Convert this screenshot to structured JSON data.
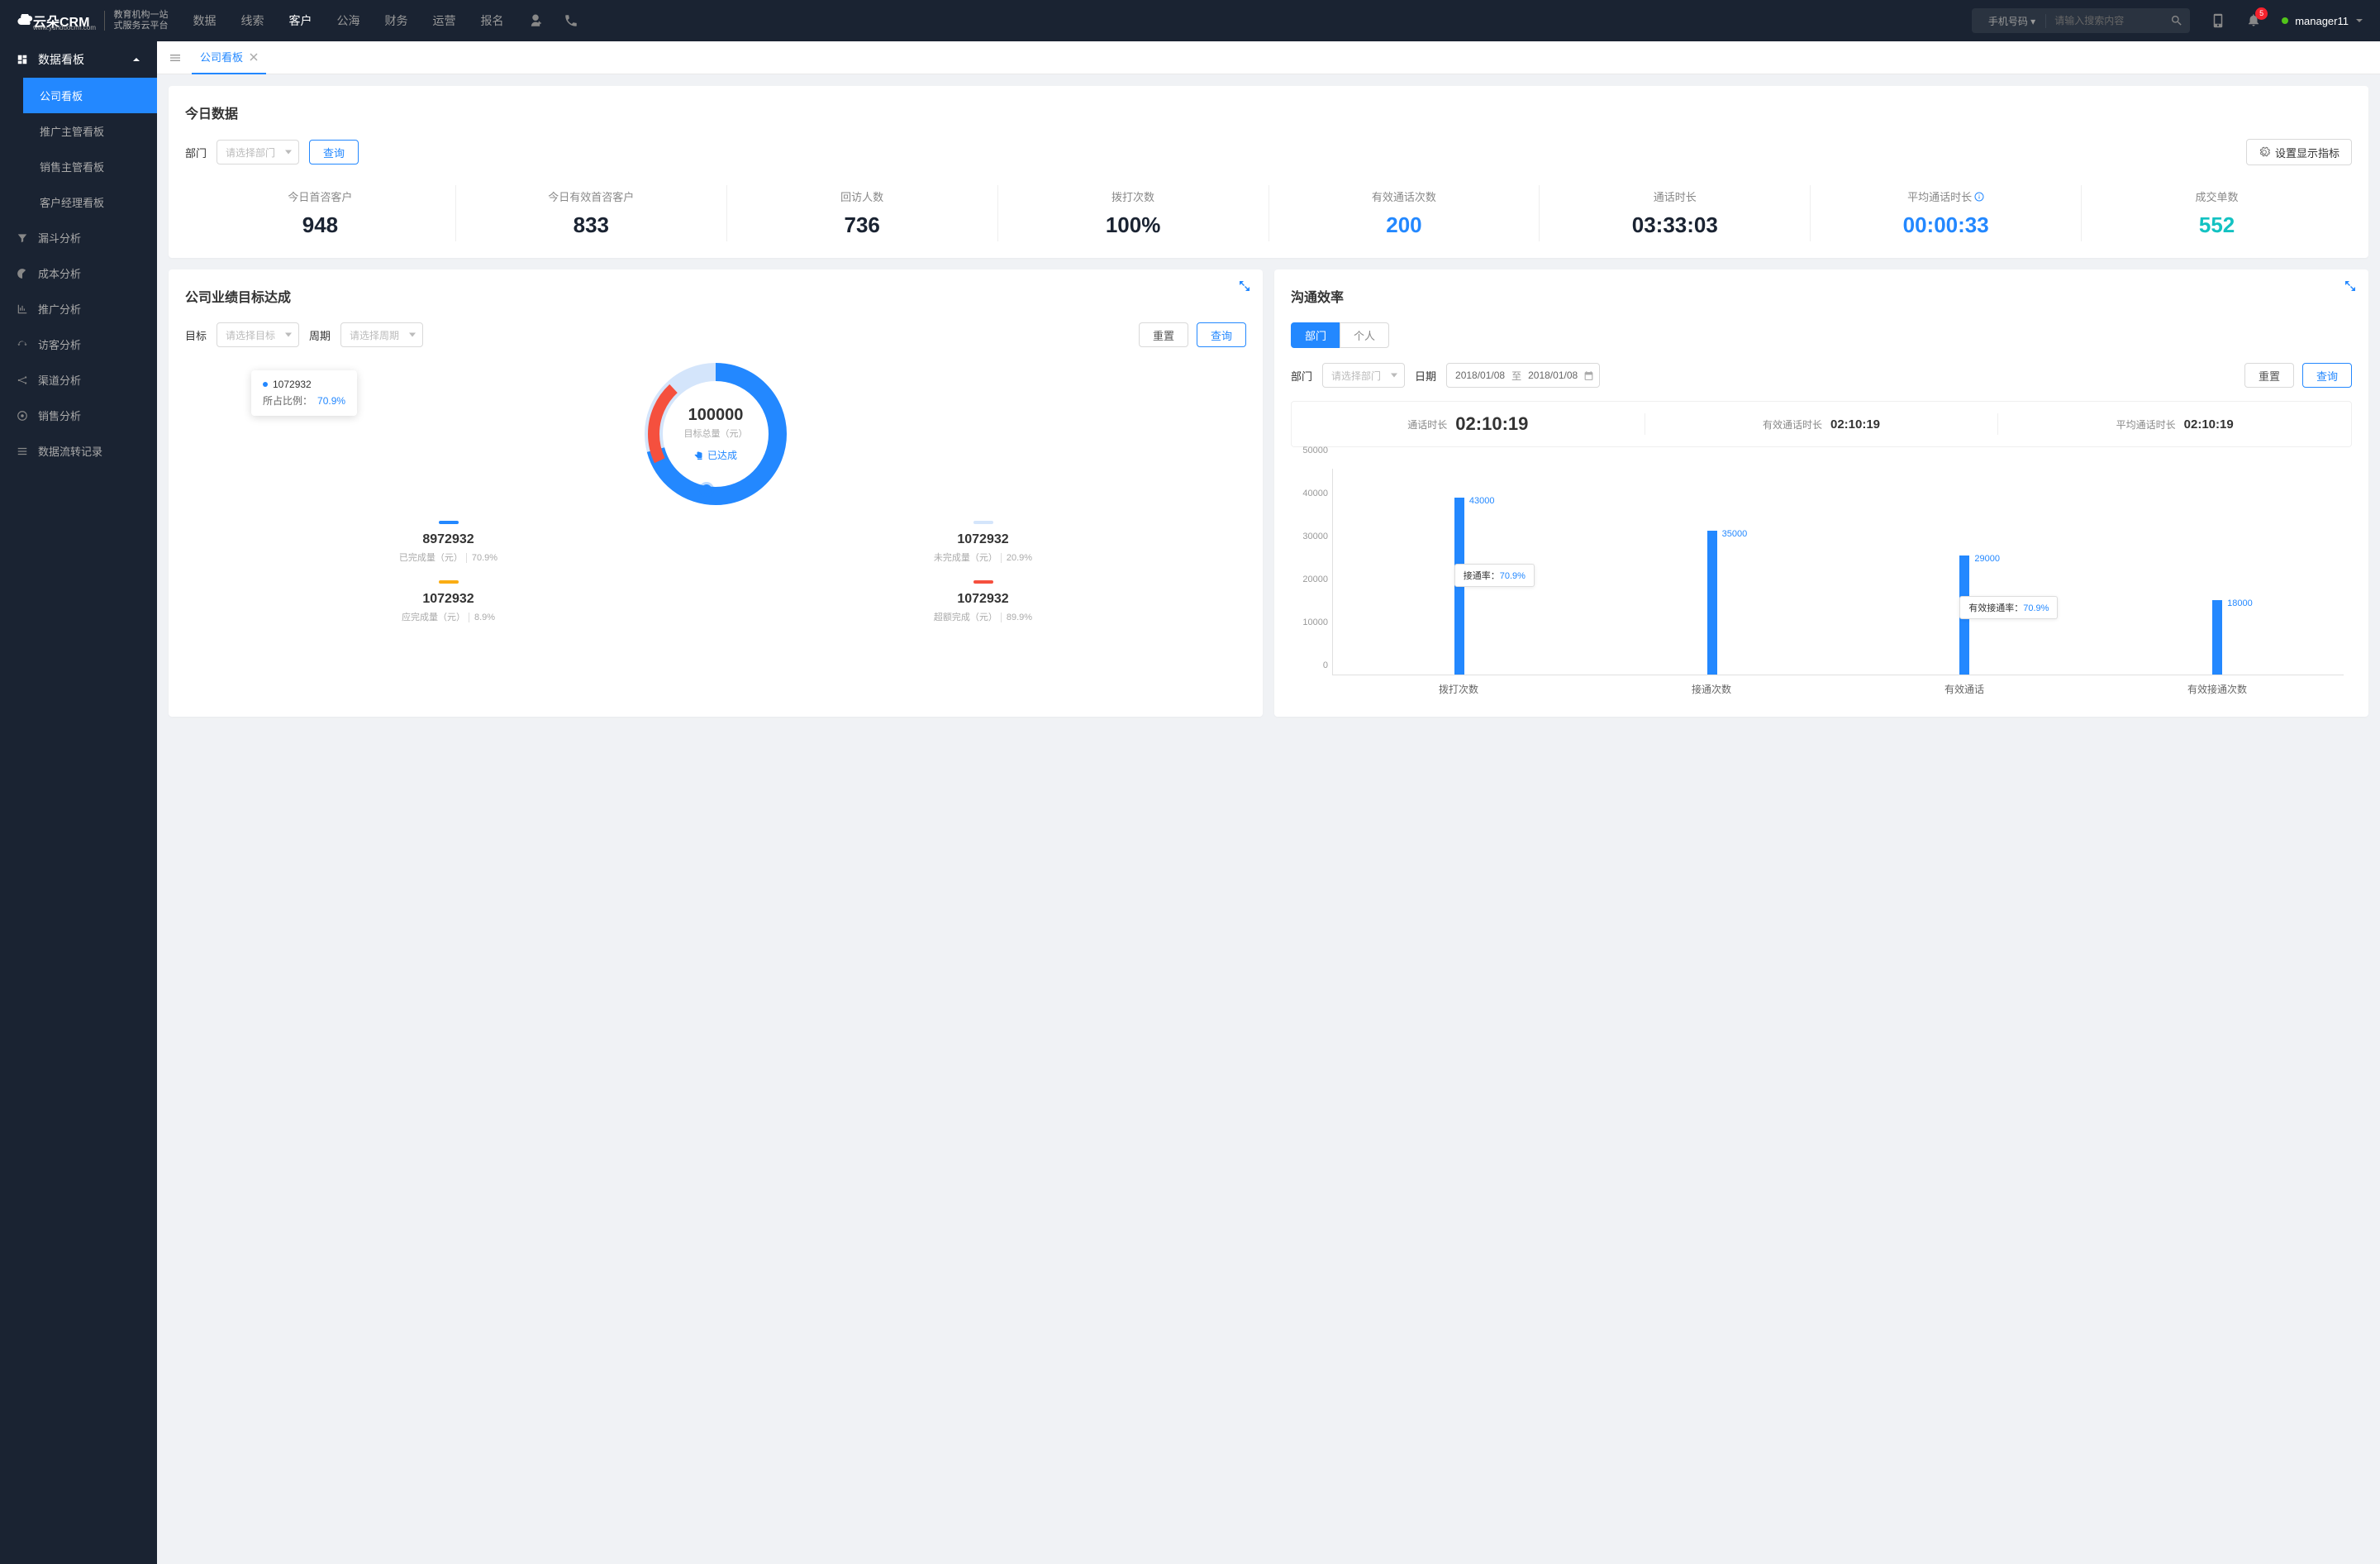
{
  "header": {
    "logo_main": "云朵CRM",
    "logo_url": "www.yunduocrm.com",
    "logo_sub1": "教育机构一站",
    "logo_sub2": "式服务云平台",
    "nav": [
      "数据",
      "线索",
      "客户",
      "公海",
      "财务",
      "运营",
      "报名"
    ],
    "nav_active_index": 2,
    "search_select": "手机号码",
    "search_placeholder": "请输入搜索内容",
    "badge": "5",
    "user": "manager11"
  },
  "sidebar": {
    "group_title": "数据看板",
    "group_items": [
      "公司看板",
      "推广主管看板",
      "销售主管看板",
      "客户经理看板"
    ],
    "group_active_index": 0,
    "items": [
      "漏斗分析",
      "成本分析",
      "推广分析",
      "访客分析",
      "渠道分析",
      "销售分析",
      "数据流转记录"
    ]
  },
  "tabs": {
    "tab1": "公司看板"
  },
  "today": {
    "title": "今日数据",
    "dept_label": "部门",
    "dept_placeholder": "请选择部门",
    "query_btn": "查询",
    "settings_btn": "设置显示指标",
    "stats": [
      {
        "label": "今日首咨客户",
        "value": "948",
        "cls": "c-dark"
      },
      {
        "label": "今日有效首咨客户",
        "value": "833",
        "cls": "c-dark"
      },
      {
        "label": "回访人数",
        "value": "736",
        "cls": "c-dark"
      },
      {
        "label": "拨打次数",
        "value": "100%",
        "cls": "c-dark"
      },
      {
        "label": "有效通话次数",
        "value": "200",
        "cls": "c-blue"
      },
      {
        "label": "通话时长",
        "value": "03:33:03",
        "cls": "c-dark"
      },
      {
        "label": "平均通话时长",
        "value": "00:00:33",
        "cls": "c-blue",
        "info": true
      },
      {
        "label": "成交单数",
        "value": "552",
        "cls": "c-cyan"
      }
    ]
  },
  "goals": {
    "title": "公司业绩目标达成",
    "target_label": "目标",
    "target_placeholder": "请选择目标",
    "period_label": "周期",
    "period_placeholder": "请选择周期",
    "reset_btn": "重置",
    "query_btn": "查询",
    "tooltip_value": "1072932",
    "tooltip_pct_label": "所占比例：",
    "tooltip_pct": "70.9%",
    "center_value": "100000",
    "center_label": "目标总量（元）",
    "status_text": "已达成",
    "legend": [
      {
        "value": "8972932",
        "label": "已完成量（元）",
        "pct": "70.9%",
        "cls": "lg-blue"
      },
      {
        "value": "1072932",
        "label": "未完成量（元）",
        "pct": "20.9%",
        "cls": "lg-light"
      },
      {
        "value": "1072932",
        "label": "应完成量（元）",
        "pct": "8.9%",
        "cls": "lg-orange"
      },
      {
        "value": "1072932",
        "label": "超额完成（元）",
        "pct": "89.9%",
        "cls": "lg-red"
      }
    ]
  },
  "comm": {
    "title": "沟通效率",
    "seg_dept": "部门",
    "seg_person": "个人",
    "dept_label": "部门",
    "dept_placeholder": "请选择部门",
    "date_label": "日期",
    "date_from": "2018/01/08",
    "date_sep": "至",
    "date_to": "2018/01/08",
    "reset_btn": "重置",
    "query_btn": "查询",
    "times": [
      {
        "label": "通话时长",
        "value": "02:10:19",
        "big": true
      },
      {
        "label": "有效通话时长",
        "value": "02:10:19"
      },
      {
        "label": "平均通话时长",
        "value": "02:10:19"
      }
    ],
    "anno1_label": "接通率：",
    "anno1_pct": "70.9%",
    "anno2_label": "有效接通率：",
    "anno2_pct": "70.9%"
  },
  "chart_data": {
    "type": "bar",
    "categories": [
      "拨打次数",
      "接通次数",
      "有效通话",
      "有效接通次数"
    ],
    "values": [
      43000,
      35000,
      29000,
      18000
    ],
    "ylabel": "",
    "ylim": [
      0,
      50000
    ],
    "yticks": [
      0,
      10000,
      20000,
      30000,
      40000,
      50000
    ]
  }
}
